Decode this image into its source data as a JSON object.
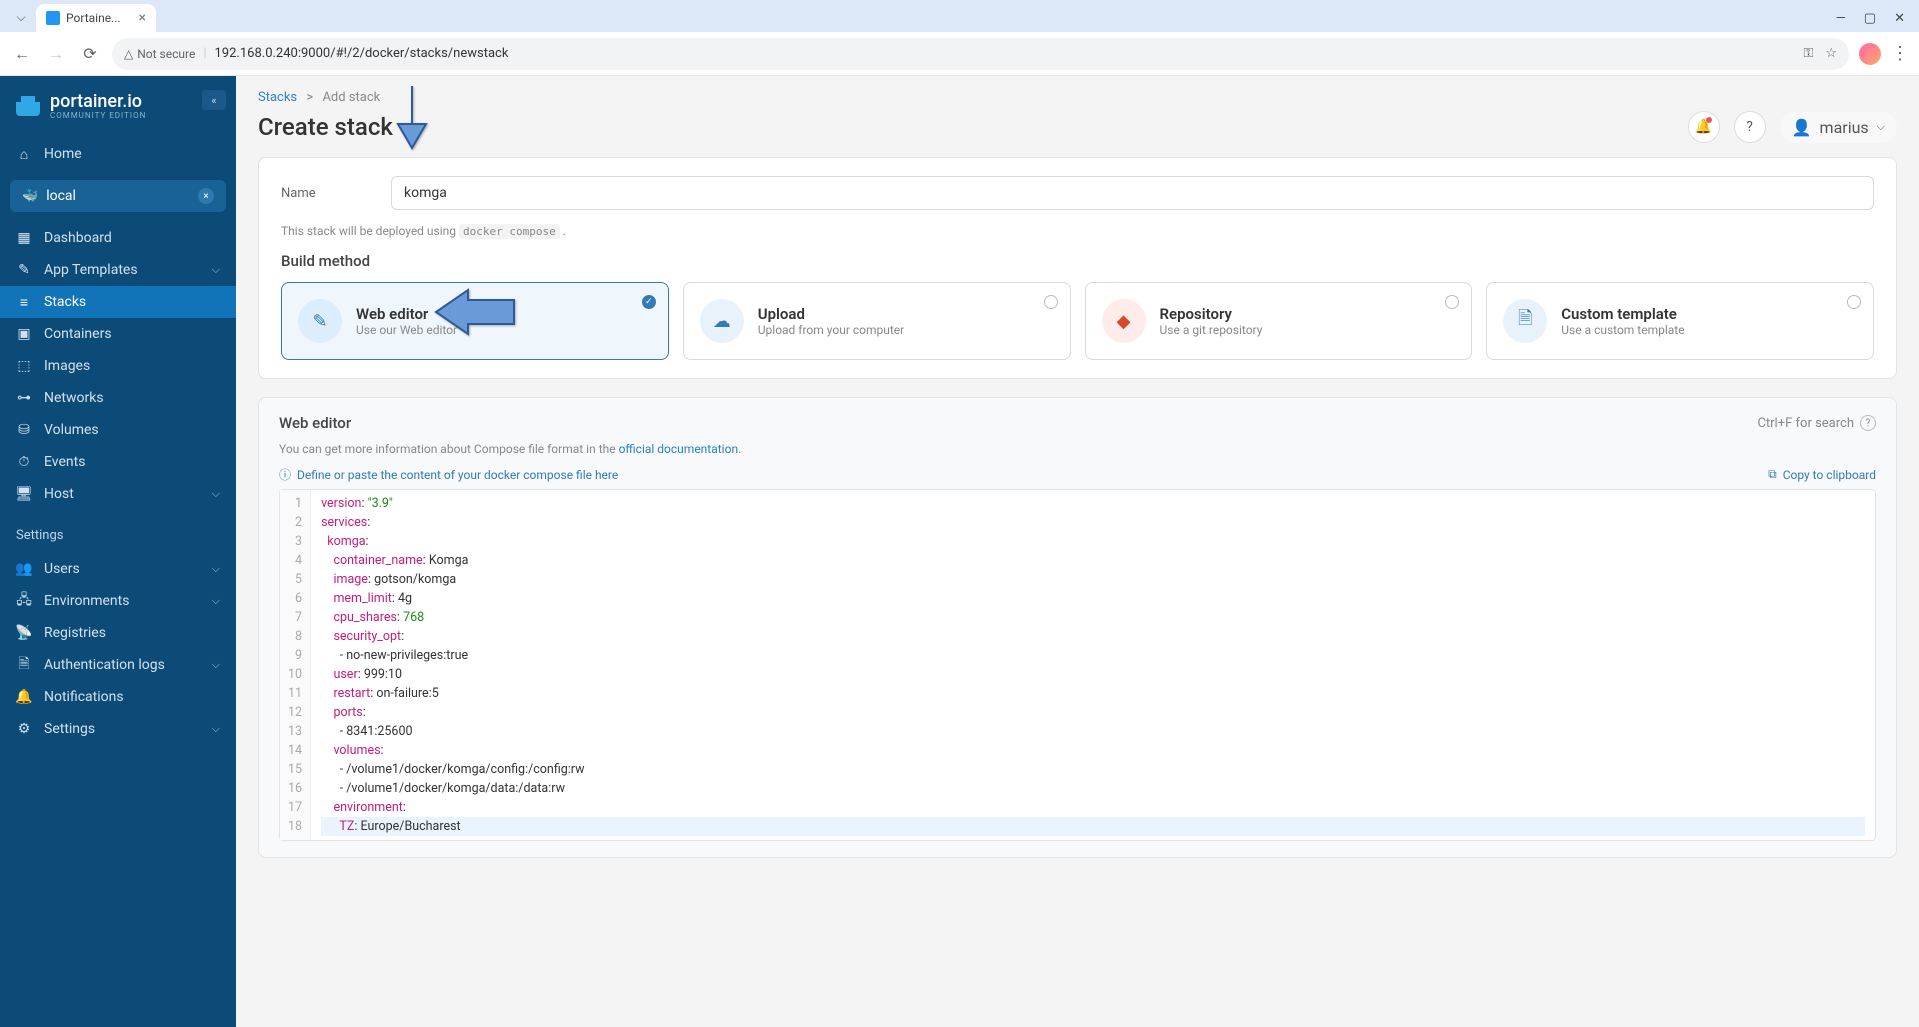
{
  "browser": {
    "tab_title": "Portaine...",
    "url_security": "Not secure",
    "url": "192.168.0.240:9000/#!/2/docker/stacks/newstack"
  },
  "sidebar": {
    "logo_text": "portainer.io",
    "logo_sub": "COMMUNITY EDITION",
    "home": "Home",
    "env_name": "local",
    "items": [
      {
        "label": "Dashboard"
      },
      {
        "label": "App Templates"
      },
      {
        "label": "Stacks"
      },
      {
        "label": "Containers"
      },
      {
        "label": "Images"
      },
      {
        "label": "Networks"
      },
      {
        "label": "Volumes"
      },
      {
        "label": "Events"
      },
      {
        "label": "Host"
      }
    ],
    "settings_label": "Settings",
    "settings_items": [
      {
        "label": "Users"
      },
      {
        "label": "Environments"
      },
      {
        "label": "Registries"
      },
      {
        "label": "Authentication logs"
      },
      {
        "label": "Notifications"
      },
      {
        "label": "Settings"
      }
    ]
  },
  "breadcrumb": {
    "root": "Stacks",
    "sep": ">",
    "leaf": "Add stack"
  },
  "page_title": "Create stack",
  "user_name": "marius",
  "form": {
    "name_label": "Name",
    "name_value": "komga",
    "helper_prefix": "This stack will be deployed using ",
    "helper_code": "docker compose",
    "helper_suffix": " ."
  },
  "build": {
    "section": "Build method",
    "methods": [
      {
        "title": "Web editor",
        "sub": "Use our Web editor"
      },
      {
        "title": "Upload",
        "sub": "Upload from your computer"
      },
      {
        "title": "Repository",
        "sub": "Use a git repository"
      },
      {
        "title": "Custom template",
        "sub": "Use a custom template"
      }
    ]
  },
  "editor": {
    "title": "Web editor",
    "search_hint": "Ctrl+F for search",
    "help_prefix": "You can get more information about Compose file format in the ",
    "help_link": "official documentation",
    "help_suffix": ".",
    "hint": "Define or paste the content of your docker compose file here",
    "copy": "Copy to clipboard",
    "lines": [
      [
        {
          "t": "key",
          "v": "version"
        },
        {
          "t": "punc",
          "v": ": "
        },
        {
          "t": "str",
          "v": "\"3.9\""
        }
      ],
      [
        {
          "t": "key",
          "v": "services"
        },
        {
          "t": "punc",
          "v": ":"
        }
      ],
      [
        {
          "t": "plain",
          "v": "  "
        },
        {
          "t": "key",
          "v": "komga"
        },
        {
          "t": "punc",
          "v": ":"
        }
      ],
      [
        {
          "t": "plain",
          "v": "    "
        },
        {
          "t": "key",
          "v": "container_name"
        },
        {
          "t": "punc",
          "v": ": "
        },
        {
          "t": "plain",
          "v": "Komga"
        }
      ],
      [
        {
          "t": "plain",
          "v": "    "
        },
        {
          "t": "key",
          "v": "image"
        },
        {
          "t": "punc",
          "v": ": "
        },
        {
          "t": "plain",
          "v": "gotson/komga"
        }
      ],
      [
        {
          "t": "plain",
          "v": "    "
        },
        {
          "t": "key",
          "v": "mem_limit"
        },
        {
          "t": "punc",
          "v": ": "
        },
        {
          "t": "plain",
          "v": "4g"
        }
      ],
      [
        {
          "t": "plain",
          "v": "    "
        },
        {
          "t": "key",
          "v": "cpu_shares"
        },
        {
          "t": "punc",
          "v": ": "
        },
        {
          "t": "num",
          "v": "768"
        }
      ],
      [
        {
          "t": "plain",
          "v": "    "
        },
        {
          "t": "key",
          "v": "security_opt"
        },
        {
          "t": "punc",
          "v": ":"
        }
      ],
      [
        {
          "t": "plain",
          "v": "      - "
        },
        {
          "t": "plain",
          "v": "no-new-privileges:true"
        }
      ],
      [
        {
          "t": "plain",
          "v": "    "
        },
        {
          "t": "key",
          "v": "user"
        },
        {
          "t": "punc",
          "v": ": "
        },
        {
          "t": "plain",
          "v": "999:10"
        }
      ],
      [
        {
          "t": "plain",
          "v": "    "
        },
        {
          "t": "key",
          "v": "restart"
        },
        {
          "t": "punc",
          "v": ": "
        },
        {
          "t": "plain",
          "v": "on-failure:5"
        }
      ],
      [
        {
          "t": "plain",
          "v": "    "
        },
        {
          "t": "key",
          "v": "ports"
        },
        {
          "t": "punc",
          "v": ":"
        }
      ],
      [
        {
          "t": "plain",
          "v": "      - "
        },
        {
          "t": "plain",
          "v": "8341:25600"
        }
      ],
      [
        {
          "t": "plain",
          "v": "    "
        },
        {
          "t": "key",
          "v": "volumes"
        },
        {
          "t": "punc",
          "v": ":"
        }
      ],
      [
        {
          "t": "plain",
          "v": "      - "
        },
        {
          "t": "plain",
          "v": "/volume1/docker/komga/config:/config:rw"
        }
      ],
      [
        {
          "t": "plain",
          "v": "      - "
        },
        {
          "t": "plain",
          "v": "/volume1/docker/komga/data:/data:rw"
        }
      ],
      [
        {
          "t": "plain",
          "v": "    "
        },
        {
          "t": "key",
          "v": "environment"
        },
        {
          "t": "punc",
          "v": ":"
        }
      ],
      [
        {
          "t": "plain",
          "v": "      "
        },
        {
          "t": "key",
          "v": "TZ"
        },
        {
          "t": "punc",
          "v": ": "
        },
        {
          "t": "plain",
          "v": "Europe/Bucharest"
        }
      ]
    ]
  }
}
